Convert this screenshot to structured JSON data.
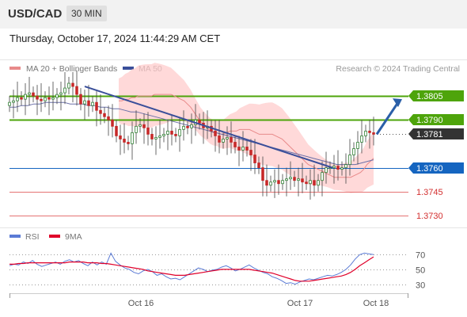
{
  "header": {
    "symbol": "USD/CAD",
    "timeframe": "30 MIN"
  },
  "timestamp": "Thursday, October 17, 2024 11:44:29 AM CET",
  "legend": {
    "ma20_bb": "MA 20 + Bollinger Bands",
    "ma50": "MA 50",
    "credit": "Research © 2024 Trading Central"
  },
  "rsi_legend": {
    "rsi": "RSI",
    "ma9": "9MA"
  },
  "colors": {
    "resistance": "#4ea40b",
    "pivot": "#1565c0",
    "support": "#e57373",
    "current": "#333333",
    "bollinger": "#ffcccc",
    "ma20": "#e88a8a",
    "ma50": "#6a70a8",
    "trendline": "#3a4f9a",
    "arrow": "#2a5fa8",
    "candle_up": "#2e7d32",
    "candle_down": "#c62828",
    "rsi": "#5b7bd5",
    "rsi_ma": "#e0002a"
  },
  "chart_data": [
    {
      "type": "candlestick",
      "title": "USD/CAD 30 MIN",
      "ylim": [
        1.3724,
        1.3818
      ],
      "x_tick_labels": [
        "Oct 16",
        "Oct 17",
        "Oct 18"
      ],
      "levels": [
        {
          "name": "resistance",
          "value": 1.3805,
          "label": "1.3805"
        },
        {
          "name": "resistance",
          "value": 1.379,
          "label": "1.3790"
        },
        {
          "name": "current",
          "value": 1.3781,
          "label": "1.3781"
        },
        {
          "name": "pivot",
          "value": 1.376,
          "label": "1.3760"
        },
        {
          "name": "support",
          "value": 1.3745,
          "label": "1.3745"
        },
        {
          "name": "support",
          "value": 1.373,
          "label": "1.3730"
        }
      ],
      "close_series": [
        1.3801,
        1.3802,
        1.3804,
        1.3803,
        1.3806,
        1.3807,
        1.3805,
        1.3803,
        1.3802,
        1.3804,
        1.3803,
        1.3804,
        1.3806,
        1.3807,
        1.381,
        1.3813,
        1.3811,
        1.3806,
        1.38,
        1.3802,
        1.3799,
        1.3801,
        1.3796,
        1.3794,
        1.3792,
        1.379,
        1.3786,
        1.378,
        1.3778,
        1.3776,
        1.3775,
        1.3782,
        1.3786,
        1.3787,
        1.3785,
        1.3781,
        1.3778,
        1.3779,
        1.378,
        1.3781,
        1.3783,
        1.3781,
        1.378,
        1.3784,
        1.3786,
        1.3785,
        1.3787,
        1.379,
        1.3788,
        1.3785,
        1.3786,
        1.3783,
        1.378,
        1.3776,
        1.3778,
        1.3779,
        1.3776,
        1.3773,
        1.3771,
        1.3773,
        1.3771,
        1.3768,
        1.3763,
        1.376,
        1.3752,
        1.3749,
        1.3751,
        1.3752,
        1.375,
        1.3752,
        1.3753,
        1.3754,
        1.3752,
        1.3753,
        1.3751,
        1.375,
        1.3752,
        1.3749,
        1.3752,
        1.3757,
        1.376,
        1.376,
        1.3761,
        1.3759,
        1.376,
        1.3762,
        1.3768,
        1.3772,
        1.3776,
        1.378,
        1.3783,
        1.3782,
        1.3781
      ],
      "ma20": [
        1.3802,
        1.3802,
        1.3803,
        1.3803,
        1.3804,
        1.3804,
        1.3805,
        1.3805,
        1.3805,
        1.3805,
        1.3805,
        1.3806,
        1.3806,
        1.3806,
        1.3806,
        1.3806,
        1.3806,
        1.3805,
        1.3804,
        1.3803,
        1.3802,
        1.38,
        1.3798,
        1.3795,
        1.3792,
        1.3789,
        1.3787,
        1.3785,
        1.3783,
        1.3782,
        1.3782,
        1.3781,
        1.3781,
        1.3782,
        1.3783,
        1.3783,
        1.3783,
        1.3784,
        1.3784,
        1.3784,
        1.3784,
        1.3783,
        1.3782,
        1.3781,
        1.3781,
        1.3781,
        1.3781,
        1.3781,
        1.378,
        1.3779,
        1.3778,
        1.3776,
        1.3774,
        1.3772,
        1.377,
        1.3768,
        1.3766,
        1.3764,
        1.3762,
        1.3761,
        1.376,
        1.3759,
        1.3758,
        1.3757,
        1.3756,
        1.3755,
        1.3754,
        1.3754,
        1.3754,
        1.3754,
        1.3754,
        1.3754,
        1.3755,
        1.3756,
        1.3757,
        1.3759,
        1.3762,
        1.3764,
        1.3766
      ],
      "ma50": [
        1.3798,
        1.3798,
        1.3799,
        1.3799,
        1.38,
        1.38,
        1.3801,
        1.3801,
        1.3801,
        1.3801,
        1.38,
        1.38,
        1.38,
        1.3799,
        1.3799,
        1.3798,
        1.3798,
        1.3797,
        1.3797,
        1.3796,
        1.3795,
        1.3795,
        1.3794,
        1.3793,
        1.3792,
        1.3791,
        1.379,
        1.3789,
        1.3788,
        1.3787,
        1.3786,
        1.3785,
        1.3784,
        1.3783,
        1.3782,
        1.3781,
        1.378,
        1.3779,
        1.3778,
        1.3777,
        1.3776,
        1.3775,
        1.3774,
        1.3773,
        1.3772,
        1.3771,
        1.377,
        1.3769,
        1.3768,
        1.3767,
        1.3766,
        1.3765,
        1.3764,
        1.3763,
        1.3762,
        1.3762,
        1.3762,
        1.3762,
        1.3763,
        1.3764,
        1.3765
      ],
      "trendline": {
        "from": 1.3811,
        "to": 1.376
      },
      "forecast_arrow": {
        "from": 1.3781,
        "to": 1.3805
      }
    },
    {
      "type": "line",
      "title": "RSI",
      "ylim": [
        22,
        80
      ],
      "y_ticks": [
        30,
        50,
        70
      ],
      "series": [
        {
          "name": "RSI",
          "values": [
            55,
            57,
            56,
            60,
            58,
            62,
            57,
            54,
            56,
            58,
            60,
            57,
            61,
            63,
            60,
            62,
            58,
            55,
            60,
            56,
            60,
            57,
            72,
            61,
            56,
            52,
            50,
            46,
            44,
            48,
            50,
            47,
            42,
            44,
            40,
            37,
            38,
            36,
            40,
            44,
            48,
            52,
            50,
            47,
            49,
            50,
            53,
            55,
            52,
            48,
            50,
            53,
            56,
            52,
            49,
            46,
            44,
            40,
            38,
            35,
            31,
            32,
            30,
            33,
            35,
            37,
            36,
            38,
            40,
            42,
            41,
            43,
            46,
            50,
            56,
            64,
            70,
            72,
            71,
            70
          ]
        },
        {
          "name": "9MA",
          "values": [
            57,
            57,
            58,
            58,
            59,
            59,
            59,
            59,
            59,
            59,
            59,
            59,
            59,
            60,
            60,
            60,
            60,
            59,
            59,
            59,
            58,
            58,
            57,
            56,
            55,
            54,
            53,
            52,
            51,
            50,
            48,
            47,
            46,
            45,
            44,
            43,
            42,
            42,
            42,
            43,
            44,
            45,
            46,
            47,
            48,
            49,
            50,
            50,
            50,
            50,
            50,
            50,
            50,
            49,
            48,
            47,
            46,
            45,
            43,
            41,
            39,
            37,
            35,
            34,
            34,
            34,
            35,
            36,
            37,
            38,
            39,
            40,
            41,
            43,
            46,
            50,
            55,
            59,
            63,
            67
          ]
        }
      ]
    }
  ]
}
